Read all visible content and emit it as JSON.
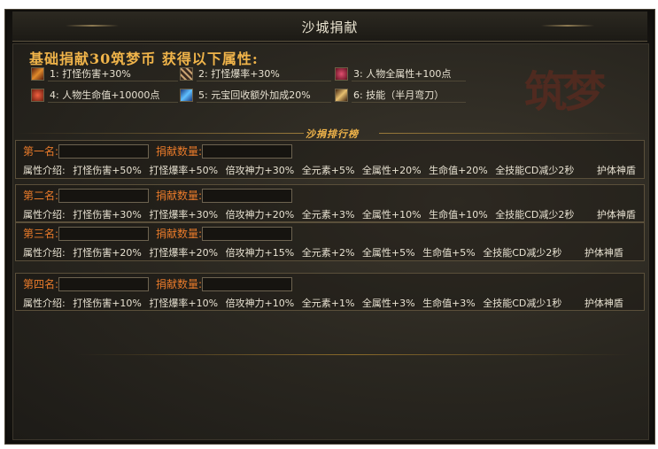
{
  "window": {
    "title": "沙城捐献"
  },
  "donation": {
    "headline": "基础捐献30筑梦币  获得以下属性:",
    "logo_text": "筑梦",
    "attributes": [
      {
        "icon": "sword-icon",
        "label": "1: 打怪伤害+30%"
      },
      {
        "icon": "crossed-swords-icon",
        "label": "2: 打怪爆率+30%"
      },
      {
        "icon": "heart-gem-icon",
        "label": "3: 人物全属性+100点"
      },
      {
        "icon": "fire-orb-icon",
        "label": "4: 人物生命值+10000点"
      },
      {
        "icon": "ingot-blue-icon",
        "label": "5: 元宝回收额外加成20%"
      },
      {
        "icon": "blade-skill-icon",
        "label": "6: 技能（半月弯刀）"
      }
    ]
  },
  "ranking": {
    "header": "沙捐排行榜",
    "amount_label": "捐献数量:",
    "desc_prefix": "属性介绍:",
    "ranks": [
      {
        "name_label": "第一名:",
        "name_value": "",
        "amount_value": "",
        "perks": [
          "打怪伤害+50%",
          "打怪爆率+50%",
          "倍攻神力+30%",
          "全元素+5%",
          "全属性+20%",
          "生命值+20%",
          "全技能CD减少2秒",
          "护体神盾"
        ]
      },
      {
        "name_label": "第二名:",
        "name_value": "",
        "amount_value": "",
        "perks": [
          "打怪伤害+30%",
          "打怪爆率+30%",
          "倍攻神力+20%",
          "全元素+3%",
          "全属性+10%",
          "生命值+10%",
          "全技能CD减少2秒",
          "护体神盾"
        ]
      },
      {
        "name_label": "第三名:",
        "name_value": "",
        "amount_value": "",
        "perks": [
          "打怪伤害+20%",
          "打怪爆率+20%",
          "倍攻神力+15%",
          "全元素+2%",
          "全属性+5%",
          "生命值+5%",
          "全技能CD减少2秒",
          "护体神盾"
        ]
      },
      {
        "name_label": "第四名:",
        "name_value": "",
        "amount_value": "",
        "perks": [
          "打怪伤害+10%",
          "打怪爆率+10%",
          "倍攻神力+10%",
          "全元素+1%",
          "全属性+3%",
          "生命值+3%",
          "全技能CD减少1秒",
          "护体神盾"
        ]
      }
    ]
  },
  "colors": {
    "accent": "#f0b44a",
    "rank_label": "#e87a2a",
    "text": "#e8e2d2"
  }
}
